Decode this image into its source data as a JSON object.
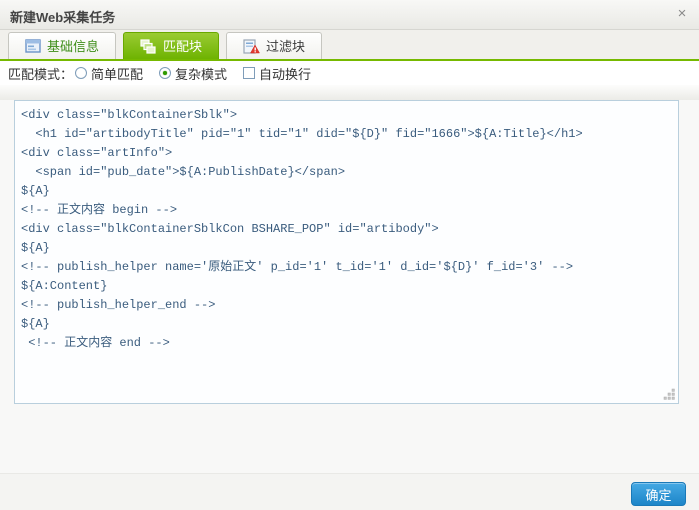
{
  "dialog": {
    "title": "新建Web采集任务",
    "close_icon": "×"
  },
  "tabs": [
    {
      "label": "基础信息",
      "icon": "form-icon",
      "active": false
    },
    {
      "label": "匹配块",
      "icon": "blocks-icon",
      "active": true
    },
    {
      "label": "过滤块",
      "icon": "filter-warning-icon",
      "active": false
    }
  ],
  "mode_bar": {
    "label": "匹配模式：",
    "options": [
      {
        "label": "简单匹配",
        "control": "radio",
        "checked": false
      },
      {
        "label": "复杂模式",
        "control": "radio",
        "checked": true
      },
      {
        "label": "自动换行",
        "control": "checkbox",
        "checked": false
      }
    ]
  },
  "editor": {
    "code_lines": [
      "<div class=\"blkContainerSblk\">",
      "  <h1 id=\"artibodyTitle\" pid=\"1\" tid=\"1\" did=\"${D}\" fid=\"1666\">${A:Title}</h1>",
      "<div class=\"artInfo\">",
      "  <span id=\"pub_date\">${A:PublishDate}</span>",
      "${A}",
      "<!-- 正文内容 begin -->",
      "<div class=\"blkContainerSblkCon BSHARE_POP\" id=\"artibody\">",
      "${A}",
      "<!-- publish_helper name='原始正文' p_id='1' t_id='1' d_id='${D}' f_id='3' -->",
      "${A:Content}",
      "<!-- publish_helper_end -->",
      "${A}",
      " <!-- 正文内容 end -->"
    ]
  },
  "footer": {
    "ok_label": "确定"
  },
  "colors": {
    "accent_green": "#76b900",
    "tab_text_green": "#3f8e1a",
    "button_blue_top": "#45a9e4",
    "button_blue_bottom": "#1d85c8",
    "code_text": "#3a5c7e",
    "editor_border": "#b9cfdd"
  }
}
